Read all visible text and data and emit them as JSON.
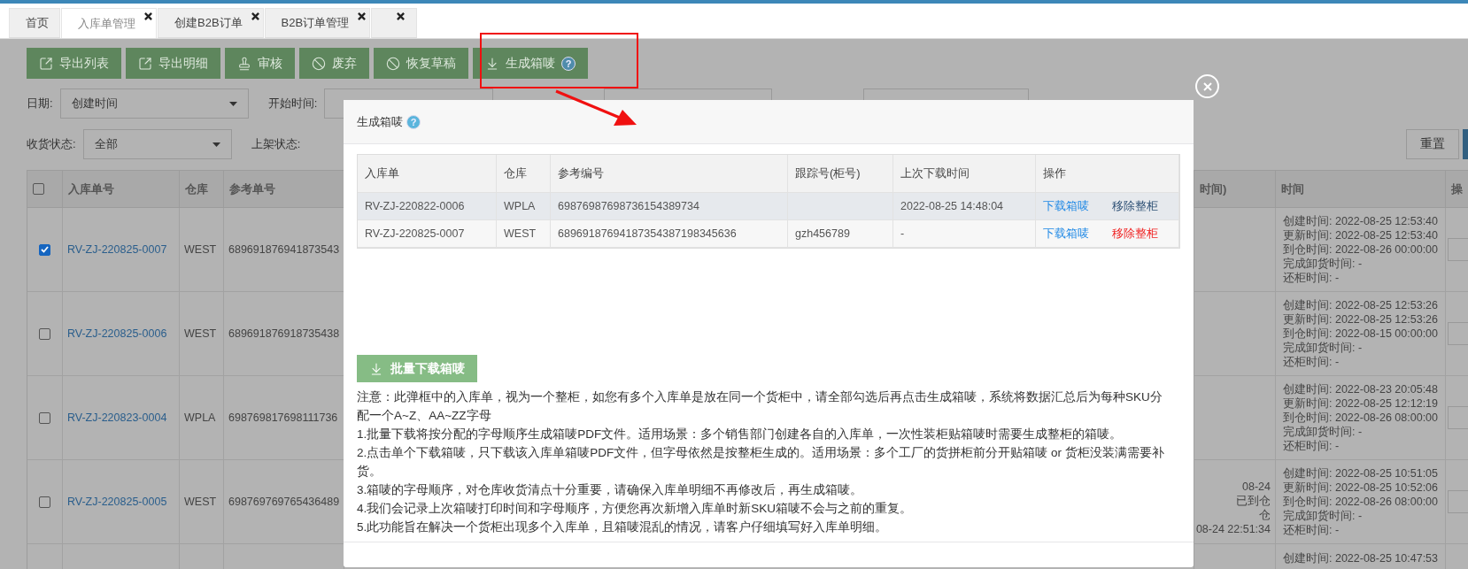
{
  "tabs": [
    {
      "label": "首页",
      "selected": false,
      "closable": false
    },
    {
      "label": "入库单管理",
      "selected": true,
      "closable": true
    },
    {
      "label": "创建B2B订单",
      "selected": false,
      "closable": true
    },
    {
      "label": "B2B订单管理",
      "selected": false,
      "closable": true
    },
    {
      "selected": false,
      "closable": true
    }
  ],
  "toolbar": [
    {
      "label": "导出列表",
      "kind": "export"
    },
    {
      "label": "导出明细",
      "kind": "export"
    },
    {
      "label": "审核",
      "kind": "stamp"
    },
    {
      "label": "废弃",
      "kind": "ban"
    },
    {
      "label": "恢复草稿",
      "kind": "ban"
    },
    {
      "label": "生成箱唛",
      "kind": "download",
      "help": "?"
    }
  ],
  "filters": [
    {
      "label": "日期:",
      "kind": "select",
      "value": "创建时间"
    },
    {
      "label": "开始时间:",
      "kind": "input"
    },
    {
      "kind": "input"
    },
    {
      "kind": "input"
    },
    {
      "label": "收货状态:",
      "kind": "select",
      "value": "全部"
    },
    {
      "label": "上架状态:",
      "kind": "label"
    }
  ],
  "reset_button": "重置",
  "table": {
    "all_checked": false,
    "columns": [
      "入库单号",
      "仓库",
      "参考单号",
      "时间)",
      "时间",
      "操"
    ],
    "rows": [
      {
        "checked": true,
        "id": "RV-ZJ-220825-0007",
        "warehouse": "WEST",
        "ref": "689691876941873543",
        "times": [
          "创建时间: 2022-08-25 12:53:40",
          "更新时间: 2022-08-25 12:53:40",
          "到仓时间: 2022-08-26 00:00:00",
          "完成卸货时间: -",
          "还柜时间: -"
        ]
      },
      {
        "checked": false,
        "id": "RV-ZJ-220825-0006",
        "warehouse": "WEST",
        "ref": "689691876918735438",
        "times": [
          "创建时间: 2022-08-25 12:53:26",
          "更新时间: 2022-08-25 12:53:26",
          "到仓时间: 2022-08-15 00:00:00",
          "完成卸货时间: -",
          "还柜时间: -"
        ]
      },
      {
        "checked": false,
        "id": "RV-ZJ-220823-0004",
        "warehouse": "WPLA",
        "ref": "698769817698111736",
        "times": [
          "创建时间: 2022-08-23 20:05:48",
          "更新时间: 2022-08-25 12:12:19",
          "到仓时间: 2022-08-26 08:00:00",
          "完成卸货时间: -",
          "还柜时间: -"
        ]
      },
      {
        "checked": false,
        "id": "RV-ZJ-220825-0005",
        "warehouse": "WEST",
        "ref": "698769769765436489",
        "partial": [
          "08-24",
          "已到仓",
          "仓",
          "08-24 22:51:34"
        ],
        "times": [
          "创建时间: 2022-08-25 10:51:05",
          "更新时间: 2022-08-25 10:52:06",
          "到仓时间: 2022-08-26 08:00:00",
          "完成卸货时间: -",
          "还柜时间: -"
        ]
      },
      {
        "times": [
          "创建时间: 2022-08-25 10:47:53"
        ]
      }
    ]
  },
  "modal": {
    "title": "生成箱唛",
    "help": "?",
    "columns": [
      "入库单",
      "仓库",
      "参考编号",
      "跟踪号(柜号)",
      "上次下载时间",
      "操作"
    ],
    "rows": [
      {
        "order": "RV-ZJ-220822-0006",
        "warehouse": "WPLA",
        "ref": "69876987698736154389734",
        "last_download": "2022-08-25 14:48:04",
        "download": "下载箱唛",
        "remove": "移除整柜",
        "hovered": true
      },
      {
        "order": "RV-ZJ-220825-0007",
        "warehouse": "WEST",
        "ref": "68969187694187354387198345636",
        "tracking": "gzh456789",
        "last_download": "-",
        "download": "下载箱唛",
        "remove": "移除整柜",
        "hovered": false
      }
    ],
    "batch_button": "批量下载箱唛",
    "notes": [
      "注意：此弹框中的入库单，视为一个整柜，如您有多个入库单是放在同一个货柜中，请全部勾选后再点击生成箱唛，系统将数据汇总后为每种SKU分配一个A~Z、AA~ZZ字母",
      "1.批量下载将按分配的字母顺序生成箱唛PDF文件。适用场景：多个销售部门创建各自的入库单，一次性装柜贴箱唛时需要生成整柜的箱唛。",
      "2.点击单个下载箱唛，只下载该入库单箱唛PDF文件，但字母依然是按整柜生成的。适用场景：多个工厂的货拼柜前分开贴箱唛 or 货柜没装满需要补货。",
      "3.箱唛的字母顺序，对仓库收货清点十分重要，请确保入库单明细不再修改后，再生成箱唛。",
      "4.我们会记录上次箱唛打印时间和字母顺序，方便您再次新增入库单时新SKU箱唛不会与之前的重复。",
      "5.此功能旨在解决一个货柜出现多个入库单，且箱唛混乱的情况，请客户仔细填写好入库单明细。"
    ]
  }
}
